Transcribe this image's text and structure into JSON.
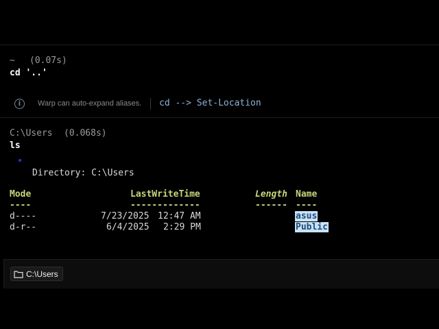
{
  "block1": {
    "dir": "~",
    "duration": "(0.07s)",
    "command": "cd '..'"
  },
  "tip": {
    "icon": "info-icon",
    "message": "Warp can auto-expand aliases.",
    "alias": "cd --> Set-Location"
  },
  "block2": {
    "dir": "C:\\Users",
    "duration": "(0.068s)",
    "command": "ls",
    "directory_line": "Directory: C:\\Users",
    "headers": {
      "mode": "Mode",
      "lastwritetime": "LastWriteTime",
      "length": "Length",
      "name": "Name"
    },
    "underlines": {
      "mode": "----",
      "lastwritetime": "-------------",
      "length": "------",
      "name": "----"
    },
    "rows": [
      {
        "mode": "d----",
        "date": "7/23/2025",
        "time": "12:47 AM",
        "name": "asus"
      },
      {
        "mode": "d-r--",
        "date": "6/4/2025",
        "time": "2:29 PM",
        "name": "Public"
      }
    ]
  },
  "input": {
    "folder_icon": "folder-icon",
    "cwd": "C:\\Users"
  },
  "colors": {
    "background": "#000000",
    "header": "#c7d67a",
    "alias": "#8ab4d8",
    "highlight": "#c9e2f8"
  }
}
